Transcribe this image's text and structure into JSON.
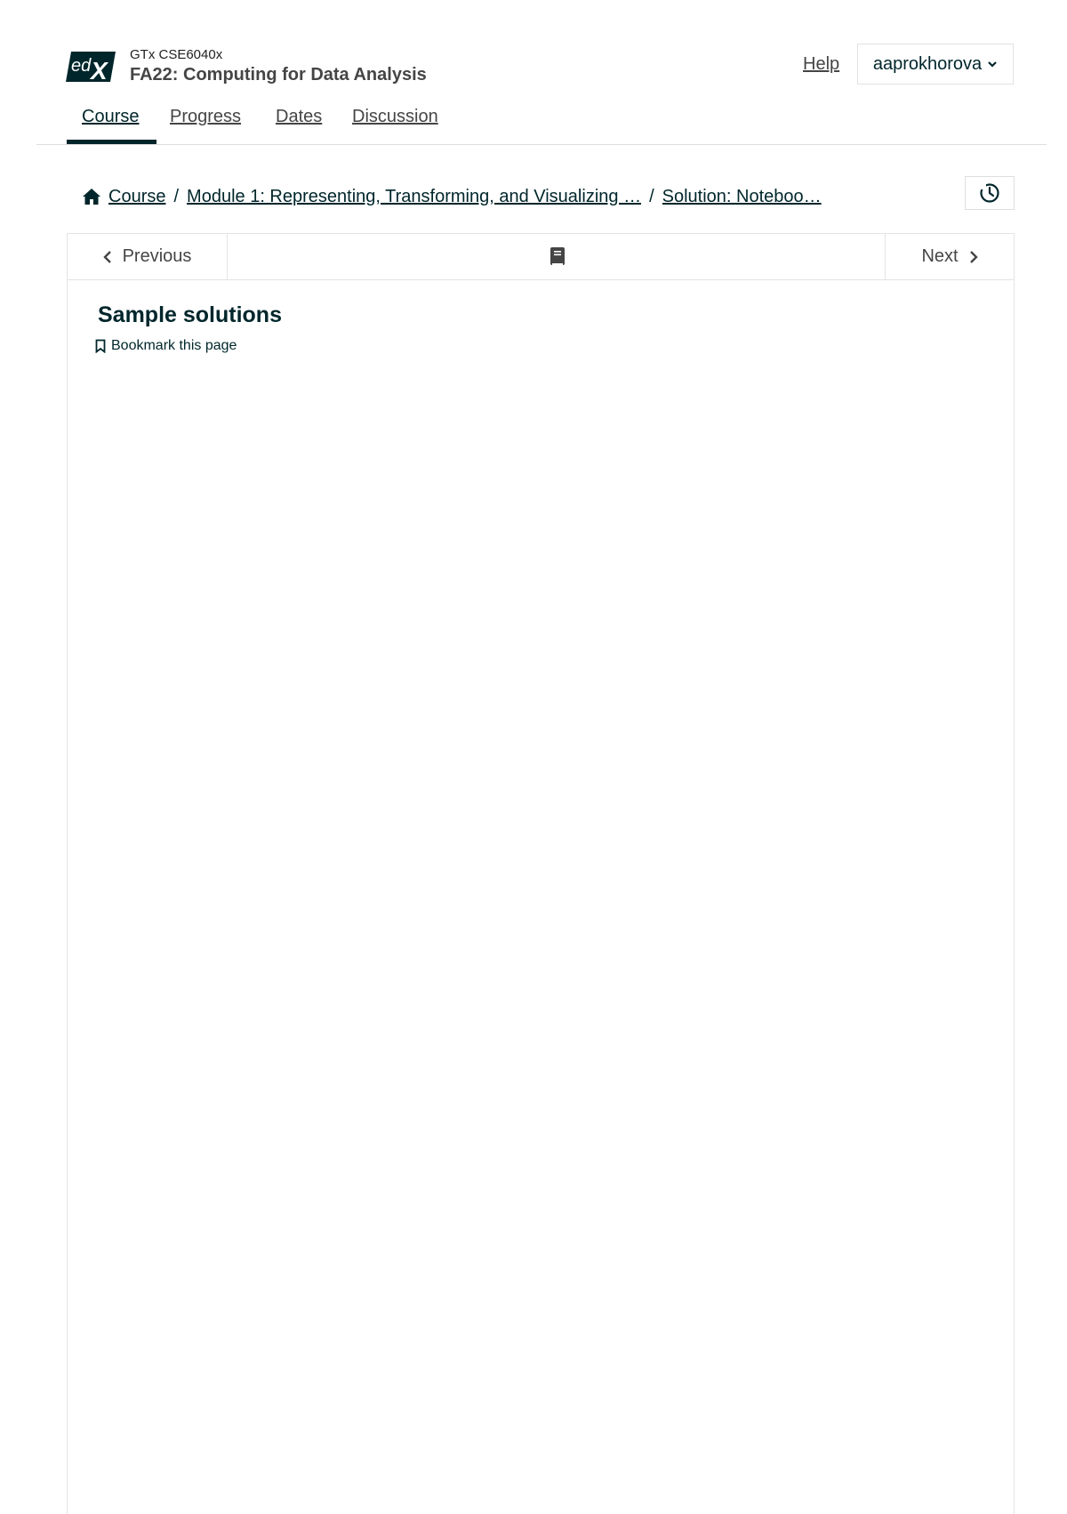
{
  "header": {
    "logo_text": "edX",
    "course_org": "GTx CSE6040x",
    "course_title": "FA22: Computing for Data Analysis",
    "help_label": "Help",
    "username": "aaprokhorova"
  },
  "tabs": [
    {
      "label": "Course",
      "active": true
    },
    {
      "label": "Progress",
      "active": false
    },
    {
      "label": "Dates",
      "active": false
    },
    {
      "label": "Discussion",
      "active": false
    }
  ],
  "breadcrumb": {
    "items": [
      "Course",
      "Module 1: Representing, Transforming, and Visualizing …",
      "Solution: Noteboo…"
    ],
    "separator": "/"
  },
  "unit_nav": {
    "previous_label": "Previous",
    "next_label": "Next"
  },
  "content": {
    "title": "Sample solutions",
    "bookmark_label": "Bookmark this page"
  },
  "colors": {
    "brand": "#00262b",
    "text_muted": "#454545",
    "border": "#e4e4e4"
  }
}
